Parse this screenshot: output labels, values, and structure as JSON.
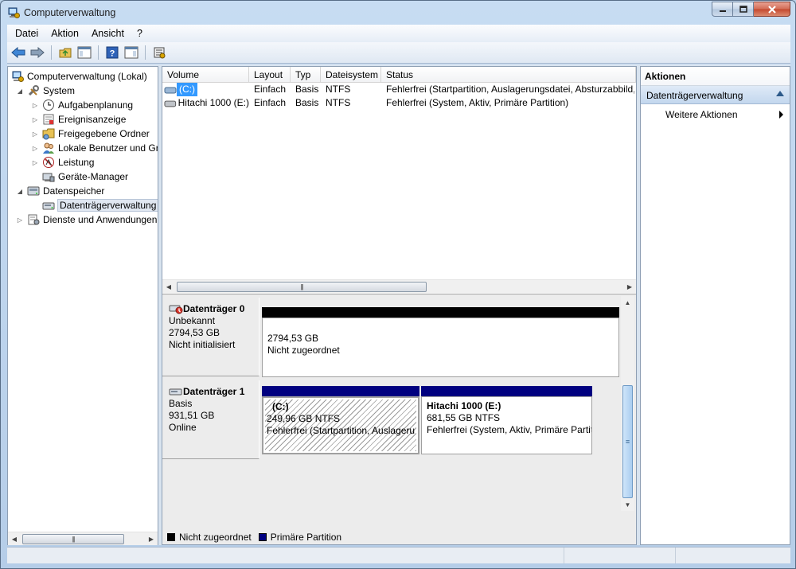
{
  "window": {
    "title": "Computerverwaltung",
    "icon": "computer-management-icon",
    "controls": [
      "minimize-icon",
      "maximize-icon",
      "close-icon"
    ]
  },
  "menu": {
    "items": [
      {
        "label": "Datei"
      },
      {
        "label": "Aktion"
      },
      {
        "label": "Ansicht"
      },
      {
        "label": "?"
      }
    ]
  },
  "toolbar": {
    "buttons": [
      "back-arrow-icon",
      "forward-arrow-icon",
      "up-folder-icon",
      "show-hide-tree-icon",
      "help-icon",
      "show-hide-action-pane-icon",
      "properties-icon"
    ]
  },
  "tree": {
    "root": "Computerverwaltung (Lokal)",
    "items": [
      {
        "label": "System",
        "icon": "tools-icon",
        "level": 1,
        "expanded": true
      },
      {
        "label": "Aufgabenplanung",
        "icon": "clock-icon",
        "level": 2
      },
      {
        "label": "Ereignisanzeige",
        "icon": "event-viewer-icon",
        "level": 2
      },
      {
        "label": "Freigegebene Ordner",
        "icon": "shared-folder-icon",
        "level": 2
      },
      {
        "label": "Lokale Benutzer und Gruppen",
        "icon": "users-icon",
        "level": 2
      },
      {
        "label": "Leistung",
        "icon": "performance-icon",
        "level": 2
      },
      {
        "label": "Geräte-Manager",
        "icon": "device-manager-icon",
        "level": 2
      },
      {
        "label": "Datenspeicher",
        "icon": "storage-icon",
        "level": 1,
        "expanded": true
      },
      {
        "label": "Datenträgerverwaltung",
        "icon": "disk-management-icon",
        "level": 2,
        "selected": true
      },
      {
        "label": "Dienste und Anwendungen",
        "icon": "services-icon",
        "level": 1
      }
    ]
  },
  "volumes": {
    "columns": [
      "Volume",
      "Layout",
      "Typ",
      "Dateisystem",
      "Status"
    ],
    "rows": [
      {
        "volume": "(C:)",
        "layout": "Einfach",
        "typ": "Basis",
        "fs": "NTFS",
        "status": "Fehlerfrei (Startpartition, Auslagerungsdatei, Absturzabbild, Primäre Partition)"
      },
      {
        "volume": "Hitachi 1000 (E:)",
        "layout": "Einfach",
        "typ": "Basis",
        "fs": "NTFS",
        "status": "Fehlerfrei (System, Aktiv, Primäre Partition)"
      }
    ]
  },
  "disks": [
    {
      "title": "Datenträger 0",
      "type": "Unbekannt",
      "size": "2794,53 GB",
      "state": "Nicht initialisiert",
      "partitions": [
        {
          "name": "",
          "size": "2794,53 GB",
          "desc": "Nicht zugeordnet",
          "kind": "unallocated"
        }
      ]
    },
    {
      "title": "Datenträger 1",
      "type": "Basis",
      "size": "931,51 GB",
      "state": "Online",
      "partitions": [
        {
          "name": "(C:)",
          "size": "249,96 GB NTFS",
          "desc": "Fehlerfrei (Startpartition, Auslagerungsdatei, Absturzabbild, Primäre Partition)",
          "kind": "primary"
        },
        {
          "name": "Hitachi 1000  (E:)",
          "size": "681,55 GB NTFS",
          "desc": "Fehlerfrei (System, Aktiv, Primäre Partition)",
          "kind": "primary"
        }
      ]
    }
  ],
  "legend": [
    {
      "label": "Nicht zugeordnet",
      "color": "#000000"
    },
    {
      "label": "Primäre Partition",
      "color": "#000080"
    }
  ],
  "actions": {
    "header": "Aktionen",
    "section": "Datenträgerverwaltung",
    "more": "Weitere Aktionen"
  }
}
